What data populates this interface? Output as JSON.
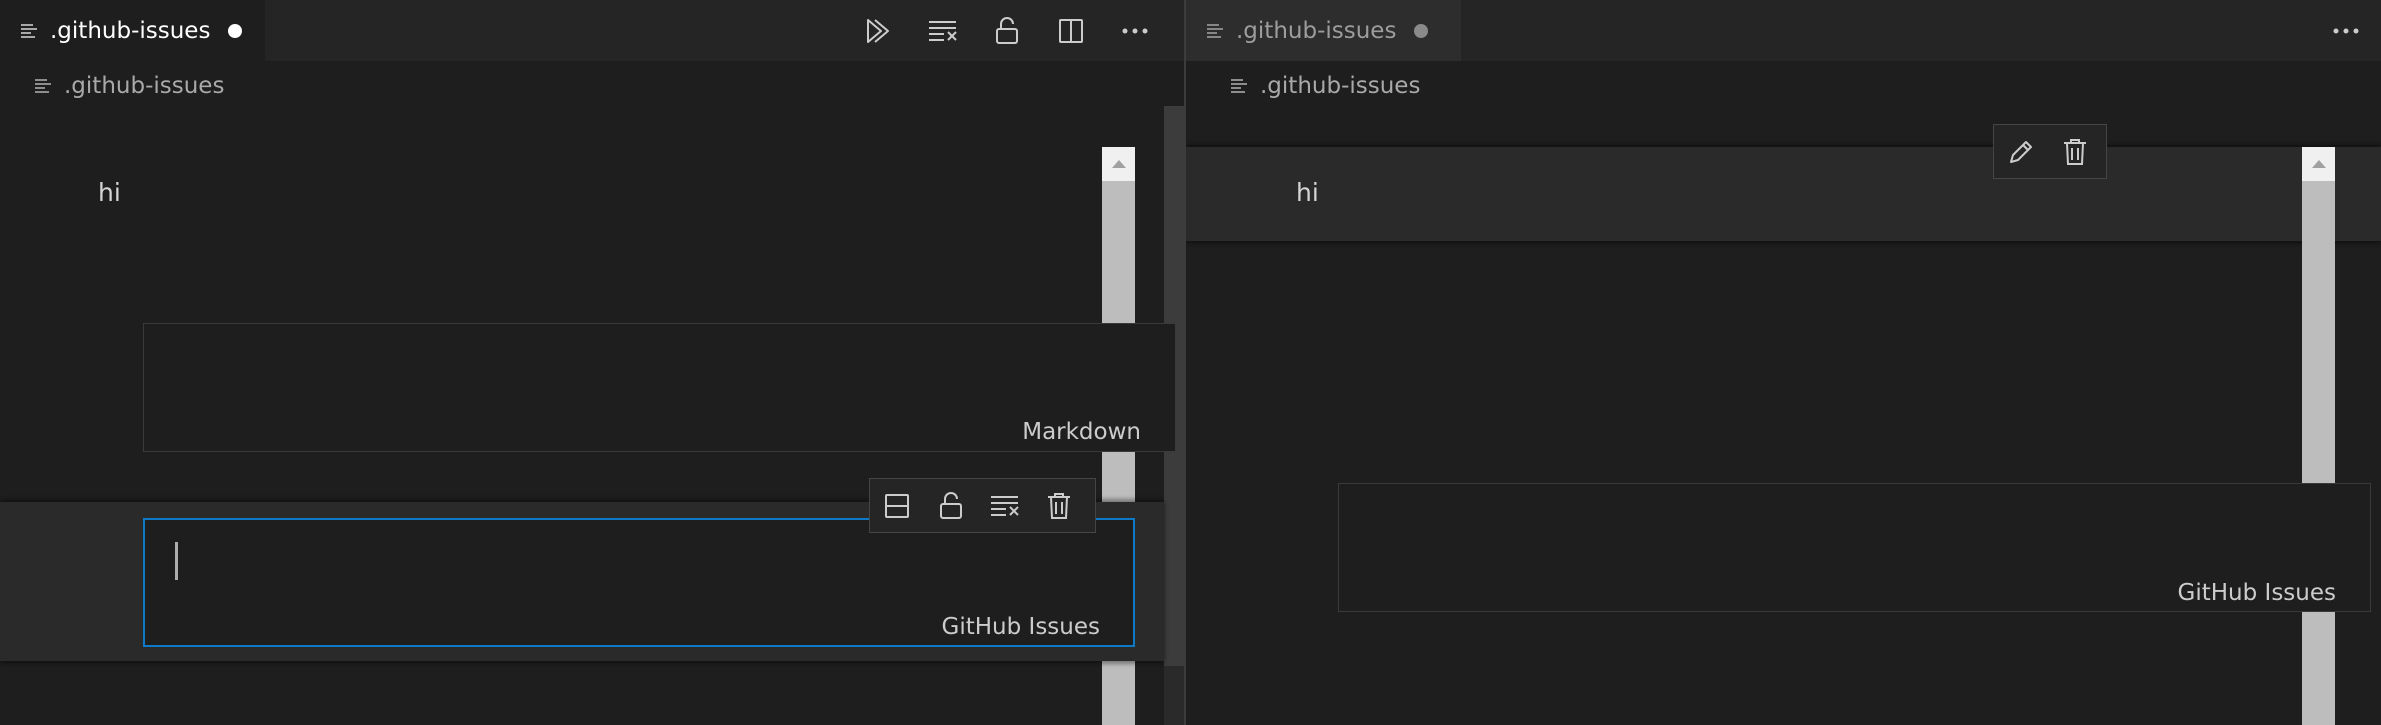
{
  "left_editor": {
    "tab": {
      "label": ".github-issues",
      "dirty": true
    },
    "breadcrumb": ".github-issues",
    "actions": [
      "run-all-icon",
      "clear-outputs-icon",
      "unlock-icon",
      "split-editor-icon",
      "more-icon"
    ],
    "cells": [
      {
        "kind": "markdown-rendered",
        "text": "hi"
      },
      {
        "kind": "code",
        "language": "Markdown",
        "content": ""
      },
      {
        "kind": "code",
        "language": "GitHub Issues",
        "content": "",
        "focused": true
      }
    ],
    "cell_toolbar": [
      "split-cell-icon",
      "unlock-icon",
      "clear-output-icon",
      "trash-icon"
    ]
  },
  "right_editor": {
    "tab": {
      "label": ".github-issues",
      "dirty": true
    },
    "breadcrumb": ".github-issues",
    "actions": [
      "more-icon"
    ],
    "cells": [
      {
        "kind": "markdown-rendered",
        "text": "hi",
        "focused": true
      },
      {
        "kind": "code",
        "language": "GitHub Issues",
        "content": ""
      }
    ],
    "cell_toolbar": [
      "edit-pencil-icon",
      "trash-icon"
    ]
  },
  "colors": {
    "background": "#1e1e1e",
    "tabbar": "#252526",
    "focus_border": "#0e79c7",
    "text": "#cccccc"
  }
}
